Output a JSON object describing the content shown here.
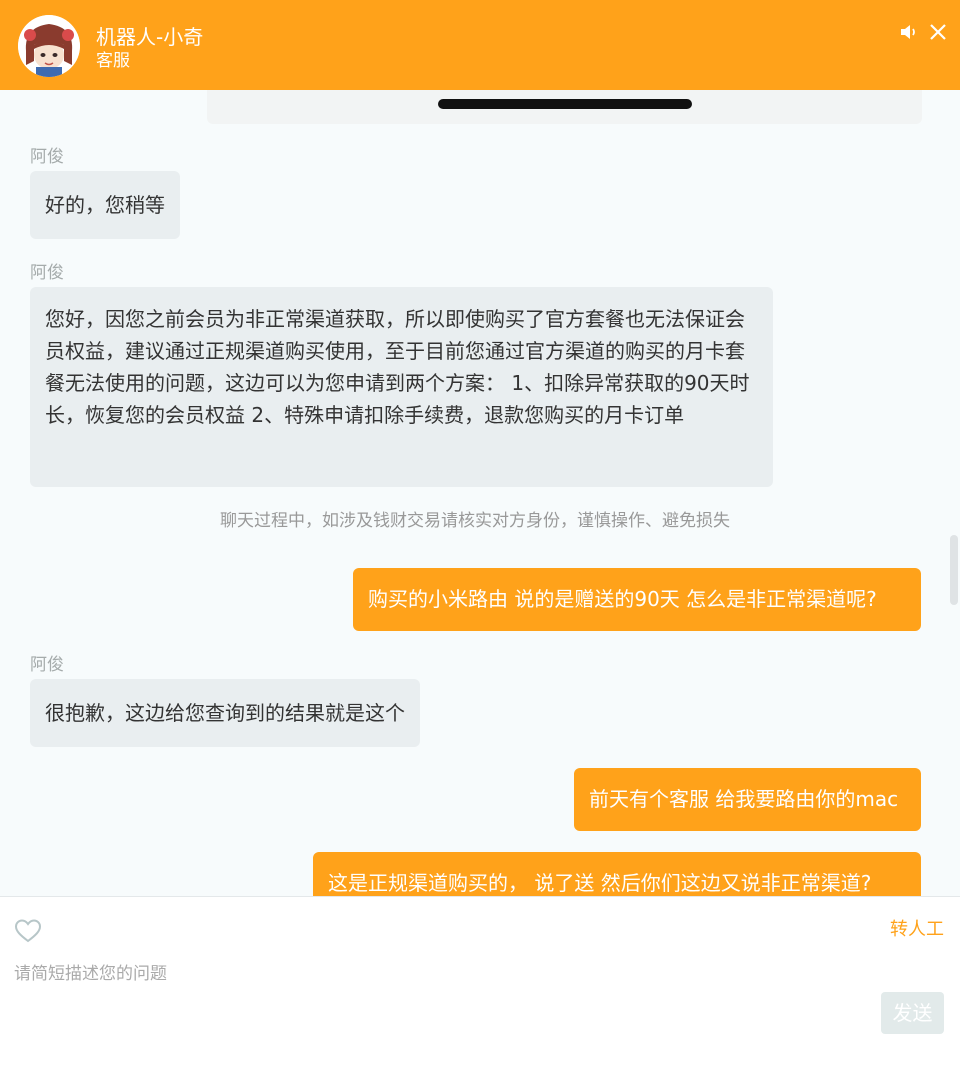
{
  "header": {
    "title": "机器人-小奇",
    "subtitle": "客服",
    "volume_icon": "speaker-icon",
    "close_icon": "close-icon"
  },
  "colors": {
    "accent": "#ffa21a",
    "incoming_bubble": "#e9eef0",
    "chat_bg": "#f7fbfc"
  },
  "messages": [
    {
      "sender": "阿俊",
      "text": "好的，您稍等"
    },
    {
      "sender": "阿俊",
      "text": "您好，因您之前会员为非正常渠道获取，所以即使购买了官方套餐也无法保证会员权益，建议通过正规渠道购买使用，至于目前您通过官方渠道的购买的月卡套餐无法使用的问题，这边可以为您申请到两个方案： 1、扣除异常获取的90天时长，恢复您的会员权益 2、特殊申请扣除手续费，退款您购买的月卡订单"
    },
    {
      "notice": "聊天过程中，如涉及钱财交易请核实对方身份，谨慎操作、避免损失"
    },
    {
      "text": "购买的小米路由 说的是赠送的90天 怎么是非正常渠道呢?"
    },
    {
      "sender": "阿俊",
      "text": "很抱歉，这边给您查询到的结果就是这个"
    },
    {
      "text": "前天有个客服 给我要路由你的mac"
    },
    {
      "text": "这是正规渠道购买的，  说了送 然后你们这边又说非正常渠道?"
    }
  ],
  "input": {
    "placeholder": "请简短描述您的问题",
    "transfer_label": "转人工",
    "send_label": "发送",
    "heart_icon": "heart-icon"
  }
}
